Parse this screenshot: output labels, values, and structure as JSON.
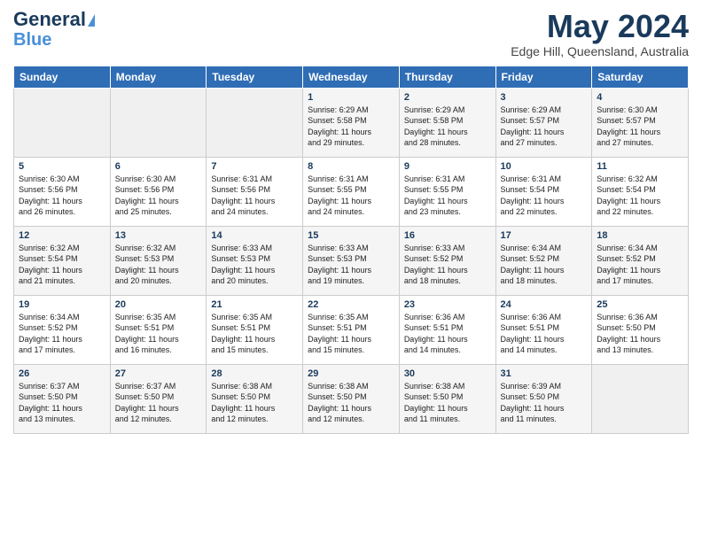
{
  "header": {
    "logo_line1": "General",
    "logo_line2": "Blue",
    "month": "May 2024",
    "location": "Edge Hill, Queensland, Australia"
  },
  "weekdays": [
    "Sunday",
    "Monday",
    "Tuesday",
    "Wednesday",
    "Thursday",
    "Friday",
    "Saturday"
  ],
  "weeks": [
    [
      {
        "day": "",
        "info": ""
      },
      {
        "day": "",
        "info": ""
      },
      {
        "day": "",
        "info": ""
      },
      {
        "day": "1",
        "info": "Sunrise: 6:29 AM\nSunset: 5:58 PM\nDaylight: 11 hours\nand 29 minutes."
      },
      {
        "day": "2",
        "info": "Sunrise: 6:29 AM\nSunset: 5:58 PM\nDaylight: 11 hours\nand 28 minutes."
      },
      {
        "day": "3",
        "info": "Sunrise: 6:29 AM\nSunset: 5:57 PM\nDaylight: 11 hours\nand 27 minutes."
      },
      {
        "day": "4",
        "info": "Sunrise: 6:30 AM\nSunset: 5:57 PM\nDaylight: 11 hours\nand 27 minutes."
      }
    ],
    [
      {
        "day": "5",
        "info": "Sunrise: 6:30 AM\nSunset: 5:56 PM\nDaylight: 11 hours\nand 26 minutes."
      },
      {
        "day": "6",
        "info": "Sunrise: 6:30 AM\nSunset: 5:56 PM\nDaylight: 11 hours\nand 25 minutes."
      },
      {
        "day": "7",
        "info": "Sunrise: 6:31 AM\nSunset: 5:56 PM\nDaylight: 11 hours\nand 24 minutes."
      },
      {
        "day": "8",
        "info": "Sunrise: 6:31 AM\nSunset: 5:55 PM\nDaylight: 11 hours\nand 24 minutes."
      },
      {
        "day": "9",
        "info": "Sunrise: 6:31 AM\nSunset: 5:55 PM\nDaylight: 11 hours\nand 23 minutes."
      },
      {
        "day": "10",
        "info": "Sunrise: 6:31 AM\nSunset: 5:54 PM\nDaylight: 11 hours\nand 22 minutes."
      },
      {
        "day": "11",
        "info": "Sunrise: 6:32 AM\nSunset: 5:54 PM\nDaylight: 11 hours\nand 22 minutes."
      }
    ],
    [
      {
        "day": "12",
        "info": "Sunrise: 6:32 AM\nSunset: 5:54 PM\nDaylight: 11 hours\nand 21 minutes."
      },
      {
        "day": "13",
        "info": "Sunrise: 6:32 AM\nSunset: 5:53 PM\nDaylight: 11 hours\nand 20 minutes."
      },
      {
        "day": "14",
        "info": "Sunrise: 6:33 AM\nSunset: 5:53 PM\nDaylight: 11 hours\nand 20 minutes."
      },
      {
        "day": "15",
        "info": "Sunrise: 6:33 AM\nSunset: 5:53 PM\nDaylight: 11 hours\nand 19 minutes."
      },
      {
        "day": "16",
        "info": "Sunrise: 6:33 AM\nSunset: 5:52 PM\nDaylight: 11 hours\nand 18 minutes."
      },
      {
        "day": "17",
        "info": "Sunrise: 6:34 AM\nSunset: 5:52 PM\nDaylight: 11 hours\nand 18 minutes."
      },
      {
        "day": "18",
        "info": "Sunrise: 6:34 AM\nSunset: 5:52 PM\nDaylight: 11 hours\nand 17 minutes."
      }
    ],
    [
      {
        "day": "19",
        "info": "Sunrise: 6:34 AM\nSunset: 5:52 PM\nDaylight: 11 hours\nand 17 minutes."
      },
      {
        "day": "20",
        "info": "Sunrise: 6:35 AM\nSunset: 5:51 PM\nDaylight: 11 hours\nand 16 minutes."
      },
      {
        "day": "21",
        "info": "Sunrise: 6:35 AM\nSunset: 5:51 PM\nDaylight: 11 hours\nand 15 minutes."
      },
      {
        "day": "22",
        "info": "Sunrise: 6:35 AM\nSunset: 5:51 PM\nDaylight: 11 hours\nand 15 minutes."
      },
      {
        "day": "23",
        "info": "Sunrise: 6:36 AM\nSunset: 5:51 PM\nDaylight: 11 hours\nand 14 minutes."
      },
      {
        "day": "24",
        "info": "Sunrise: 6:36 AM\nSunset: 5:51 PM\nDaylight: 11 hours\nand 14 minutes."
      },
      {
        "day": "25",
        "info": "Sunrise: 6:36 AM\nSunset: 5:50 PM\nDaylight: 11 hours\nand 13 minutes."
      }
    ],
    [
      {
        "day": "26",
        "info": "Sunrise: 6:37 AM\nSunset: 5:50 PM\nDaylight: 11 hours\nand 13 minutes."
      },
      {
        "day": "27",
        "info": "Sunrise: 6:37 AM\nSunset: 5:50 PM\nDaylight: 11 hours\nand 12 minutes."
      },
      {
        "day": "28",
        "info": "Sunrise: 6:38 AM\nSunset: 5:50 PM\nDaylight: 11 hours\nand 12 minutes."
      },
      {
        "day": "29",
        "info": "Sunrise: 6:38 AM\nSunset: 5:50 PM\nDaylight: 11 hours\nand 12 minutes."
      },
      {
        "day": "30",
        "info": "Sunrise: 6:38 AM\nSunset: 5:50 PM\nDaylight: 11 hours\nand 11 minutes."
      },
      {
        "day": "31",
        "info": "Sunrise: 6:39 AM\nSunset: 5:50 PM\nDaylight: 11 hours\nand 11 minutes."
      },
      {
        "day": "",
        "info": ""
      }
    ]
  ]
}
